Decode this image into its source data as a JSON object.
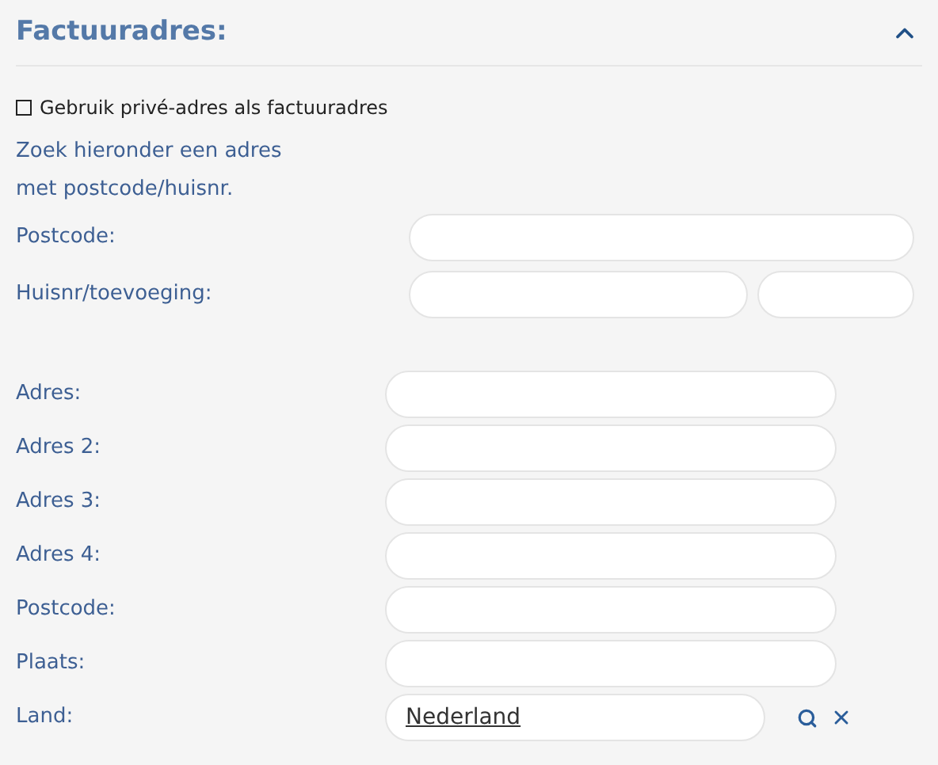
{
  "section": {
    "title": "Factuuradres:",
    "expanded": true
  },
  "checkbox": {
    "label": "Gebruik privé-adres als factuuradres",
    "checked": false
  },
  "hint_lines": [
    "Zoek hieronder een adres",
    "met postcode/huisnr."
  ],
  "lookup_fields": [
    {
      "label": "Postcode:",
      "kind": "single"
    },
    {
      "label": "Huisnr/toevoeging:",
      "kind": "split"
    }
  ],
  "address_fields": [
    {
      "label": "Adres:",
      "kind": "text"
    },
    {
      "label": "Adres 2:",
      "kind": "text"
    },
    {
      "label": "Adres 3:",
      "kind": "text"
    },
    {
      "label": "Adres 4:",
      "kind": "text"
    },
    {
      "label": "Postcode:",
      "kind": "text"
    },
    {
      "label": "Plaats:",
      "kind": "text"
    },
    {
      "label": "Land:",
      "kind": "lookup",
      "value": "Nederland"
    }
  ]
}
